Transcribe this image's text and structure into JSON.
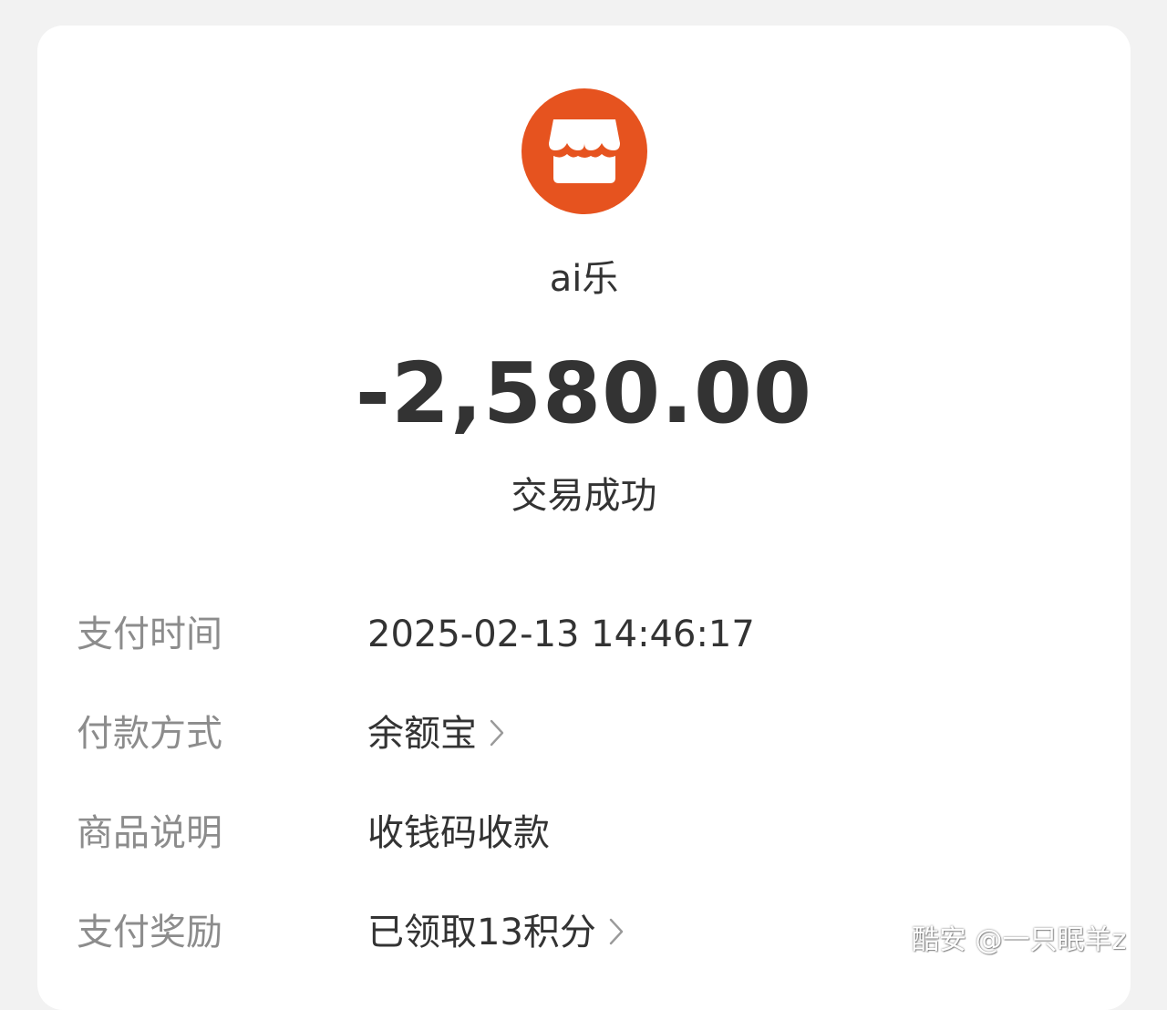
{
  "merchant": {
    "name": "ai乐",
    "avatar_icon": "storefront-icon",
    "avatar_color": "#e6531f"
  },
  "transaction": {
    "amount": "-2,580.00",
    "status": "交易成功"
  },
  "details": [
    {
      "label": "支付时间",
      "value": "2025-02-13 14:46:17"
    },
    {
      "label": "付款方式",
      "value": "余额宝"
    },
    {
      "label": "商品说明",
      "value": "收钱码收款"
    },
    {
      "label": "支付奖励",
      "value": "已领取13积分"
    }
  ],
  "watermark": "酷安 @一只眠羊z"
}
